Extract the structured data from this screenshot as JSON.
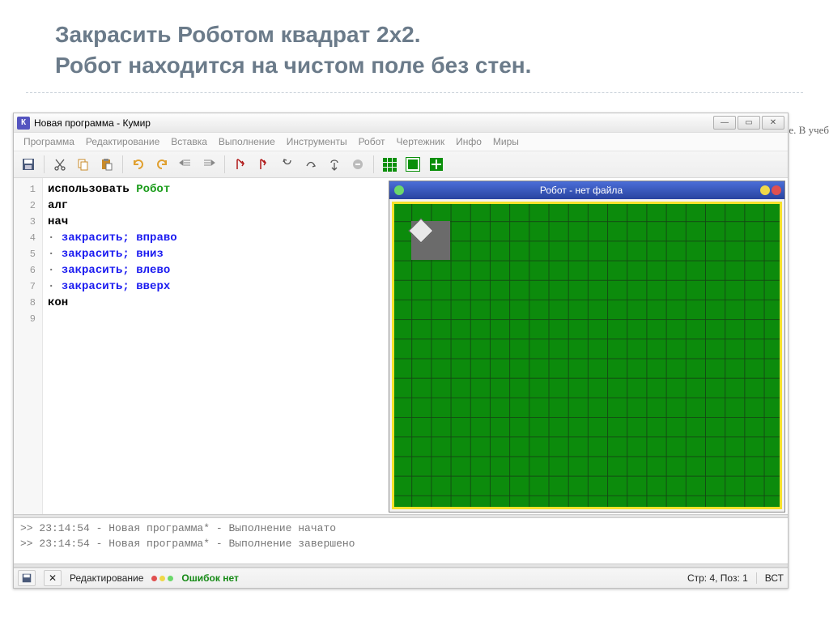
{
  "slide": {
    "title_line1": "Закрасить Роботом квадрат 2х2.",
    "title_line2": " Робот находится на чистом поле без стен."
  },
  "bg_text": "енной задаче. В учеб",
  "window": {
    "title": "Новая программа - Кумир",
    "app_icon_letter": "К"
  },
  "menu": {
    "program": "Программа",
    "editing": "Редактирование",
    "insert": "Вставка",
    "execution": "Выполнение",
    "tools": "Инструменты",
    "robot": "Робот",
    "drafter": "Чертежник",
    "info": "Инфо",
    "worlds": "Миры"
  },
  "code": {
    "line1_use": "использовать ",
    "line1_robot": "Робот",
    "line2": "алг",
    "line3": "нач",
    "bullet": "· ",
    "paint": "закрасить; ",
    "dir_right": "вправо",
    "dir_down": "вниз",
    "dir_left": "влево",
    "dir_up": "вверх",
    "line8": "кон"
  },
  "line_numbers": [
    "1",
    "2",
    "3",
    "4",
    "5",
    "6",
    "7",
    "8",
    "9"
  ],
  "robot_window": {
    "title": "Робот - нет файла"
  },
  "console": {
    "l1": ">> 23:14:54 - Новая программа* - Выполнение начато",
    "l2": ">> 23:14:54 - Новая программа* - Выполнение завершено"
  },
  "statusbar": {
    "mode": "Редактирование",
    "errors": "Ошибок нет",
    "position": "Стр: 4, Поз: 1",
    "insert_mode": "ВСТ"
  }
}
